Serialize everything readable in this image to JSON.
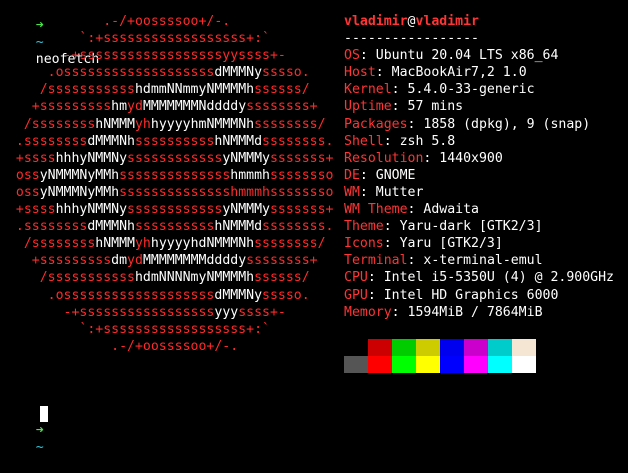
{
  "terminal": {
    "first_prompt": {
      "arrow": "➜",
      "dir": "~",
      "command": "neofetch"
    },
    "last_prompt": {
      "arrow": "➜",
      "dir": "~"
    }
  },
  "logo_lines": [
    [
      [
        "r",
        "             .-/+oossssoo+/-.              "
      ]
    ],
    [
      [
        "r",
        "          `:+ssssssssssssssssss+:`          "
      ]
    ],
    [
      [
        "r",
        "        -+ssssssssssssssssssyyssss+-        "
      ]
    ],
    [
      [
        "r",
        "      .osssssssssssssssssss"
      ],
      [
        "w",
        "dMMMNy"
      ],
      [
        "r",
        "sssso.      "
      ]
    ],
    [
      [
        "r",
        "     /sssssssssss"
      ],
      [
        "w",
        "hdmmNNmmyNMMMMh"
      ],
      [
        "r",
        "ssssss/     "
      ]
    ],
    [
      [
        "r",
        "    +sssssssss"
      ],
      [
        "w",
        "hm"
      ],
      [
        "r",
        "yd"
      ],
      [
        "w",
        "MMMMMMMNddddy"
      ],
      [
        "r",
        "ssssssss+    "
      ]
    ],
    [
      [
        "r",
        "   /ssssssss"
      ],
      [
        "w",
        "hNMMM"
      ],
      [
        "r",
        "yh"
      ],
      [
        "w",
        "hyyyyhmNMMMNh"
      ],
      [
        "r",
        "ssssssss/   "
      ]
    ],
    [
      [
        "r",
        "  .ssssssss"
      ],
      [
        "w",
        "dMMMNh"
      ],
      [
        "r",
        "ssssssssss"
      ],
      [
        "w",
        "hNMMMd"
      ],
      [
        "r",
        "ssssssss.  "
      ]
    ],
    [
      [
        "r",
        "  +ssss"
      ],
      [
        "w",
        "hhhyNMMNy"
      ],
      [
        "r",
        "ssssssssssss"
      ],
      [
        "w",
        "yNMMMy"
      ],
      [
        "r",
        "sssssss+  "
      ]
    ],
    [
      [
        "r",
        "  oss"
      ],
      [
        "w",
        "yNMMMNyMMh"
      ],
      [
        "r",
        "ssssssssssssss"
      ],
      [
        "w",
        "hmmmh"
      ],
      [
        "r",
        "ssssssso  "
      ]
    ],
    [
      [
        "r",
        "  oss"
      ],
      [
        "w",
        "yNMMMNyMMh"
      ],
      [
        "r",
        "sssssssssssssshmmmh"
      ],
      [
        "r",
        "ssssssso  "
      ]
    ],
    [
      [
        "r",
        "  +ssss"
      ],
      [
        "w",
        "hhhyNMMNy"
      ],
      [
        "r",
        "ssssssssssss"
      ],
      [
        "w",
        "yNMMMy"
      ],
      [
        "r",
        "sssssss+  "
      ]
    ],
    [
      [
        "r",
        "  .ssssssss"
      ],
      [
        "w",
        "dMMMNh"
      ],
      [
        "r",
        "ssssssssss"
      ],
      [
        "w",
        "hNMMMd"
      ],
      [
        "r",
        "ssssssss.  "
      ]
    ],
    [
      [
        "r",
        "   /ssssssss"
      ],
      [
        "w",
        "hNMMM"
      ],
      [
        "r",
        "yh"
      ],
      [
        "w",
        "hyyyyhdNMMMNh"
      ],
      [
        "r",
        "ssssssss/   "
      ]
    ],
    [
      [
        "r",
        "    +sssssssss"
      ],
      [
        "w",
        "dm"
      ],
      [
        "r",
        "yd"
      ],
      [
        "w",
        "MMMMMMMMddddy"
      ],
      [
        "r",
        "ssssssss+    "
      ]
    ],
    [
      [
        "r",
        "     /sssssssssss"
      ],
      [
        "w",
        "hdmNNNNmyNMMMMh"
      ],
      [
        "r",
        "ssssss/     "
      ]
    ],
    [
      [
        "r",
        "      .osssssssssssssssssss"
      ],
      [
        "w",
        "dMMMNy"
      ],
      [
        "r",
        "sssso.      "
      ]
    ],
    [
      [
        "r",
        "        -+sssssssssssssssss"
      ],
      [
        "w",
        "yyy"
      ],
      [
        "r",
        "ssss+-        "
      ]
    ],
    [
      [
        "r",
        "          `:+ssssssssssssssssss+:`          "
      ]
    ],
    [
      [
        "r",
        "              .-/+oossssoo+/-.              "
      ]
    ]
  ],
  "info": {
    "user": "vladimir",
    "at": "@",
    "host": "vladimir",
    "separator": "-----------------",
    "items": [
      {
        "key": "OS",
        "value": "Ubuntu 20.04 LTS x86_64"
      },
      {
        "key": "Host",
        "value": "MacBookAir7,2 1.0"
      },
      {
        "key": "Kernel",
        "value": "5.4.0-33-generic"
      },
      {
        "key": "Uptime",
        "value": "57 mins"
      },
      {
        "key": "Packages",
        "value": "1858 (dpkg), 9 (snap)"
      },
      {
        "key": "Shell",
        "value": "zsh 5.8"
      },
      {
        "key": "Resolution",
        "value": "1440x900"
      },
      {
        "key": "DE",
        "value": "GNOME"
      },
      {
        "key": "WM",
        "value": "Mutter"
      },
      {
        "key": "WM Theme",
        "value": "Adwaita"
      },
      {
        "key": "Theme",
        "value": "Yaru-dark [GTK2/3]"
      },
      {
        "key": "Icons",
        "value": "Yaru [GTK2/3]"
      },
      {
        "key": "Terminal",
        "value": "x-terminal-emul"
      },
      {
        "key": "CPU",
        "value": "Intel i5-5350U (4) @ 2.900GHz"
      },
      {
        "key": "GPU",
        "value": "Intel HD Graphics 6000"
      },
      {
        "key": "Memory",
        "value": "1594MiB / 7864MiB"
      }
    ],
    "key_suffix": ": "
  },
  "colors": {
    "background": "#000000",
    "accent_red": "#ff3434",
    "prompt_green": "#4ee04e",
    "prompt_cyan": "#33c6d9",
    "palette_top": [
      "#000000",
      "#cc0000",
      "#00cc00",
      "#cccc00",
      "#0000ee",
      "#cc00cc",
      "#00cccc",
      "#f5e6d3"
    ],
    "palette_bottom": [
      "#555555",
      "#ff0000",
      "#00ff00",
      "#ffff00",
      "#0000ff",
      "#ff00ff",
      "#00ffff",
      "#ffffff"
    ]
  }
}
